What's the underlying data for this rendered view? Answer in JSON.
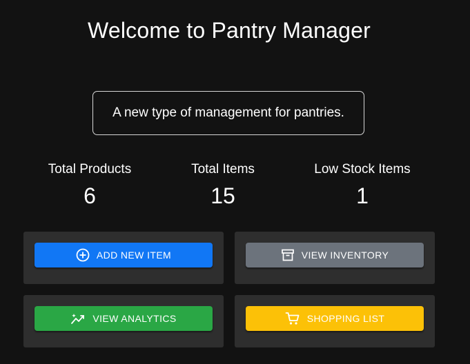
{
  "header": {
    "title": "Welcome to Pantry Manager",
    "subtitle": "A new type of management for pantries."
  },
  "stats": [
    {
      "label": "Total Products",
      "value": "6"
    },
    {
      "label": "Total Items",
      "value": "15"
    },
    {
      "label": "Low Stock Items",
      "value": "1"
    }
  ],
  "actions": {
    "add_item": {
      "label": "ADD NEW ITEM",
      "icon": "plus-circle-icon",
      "color": "#1177f5"
    },
    "view_inventory": {
      "label": "VIEW INVENTORY",
      "icon": "archive-box-icon",
      "color": "#6c737c"
    },
    "view_analytics": {
      "label": "VIEW ANALYTICS",
      "icon": "trending-up-sparkle-icon",
      "color": "#2aa745"
    },
    "shopping_list": {
      "label": "SHOPPING LIST",
      "icon": "shopping-cart-icon",
      "color": "#fcc107"
    }
  },
  "colors": {
    "background": "#121212",
    "card": "#2e2e2e"
  }
}
